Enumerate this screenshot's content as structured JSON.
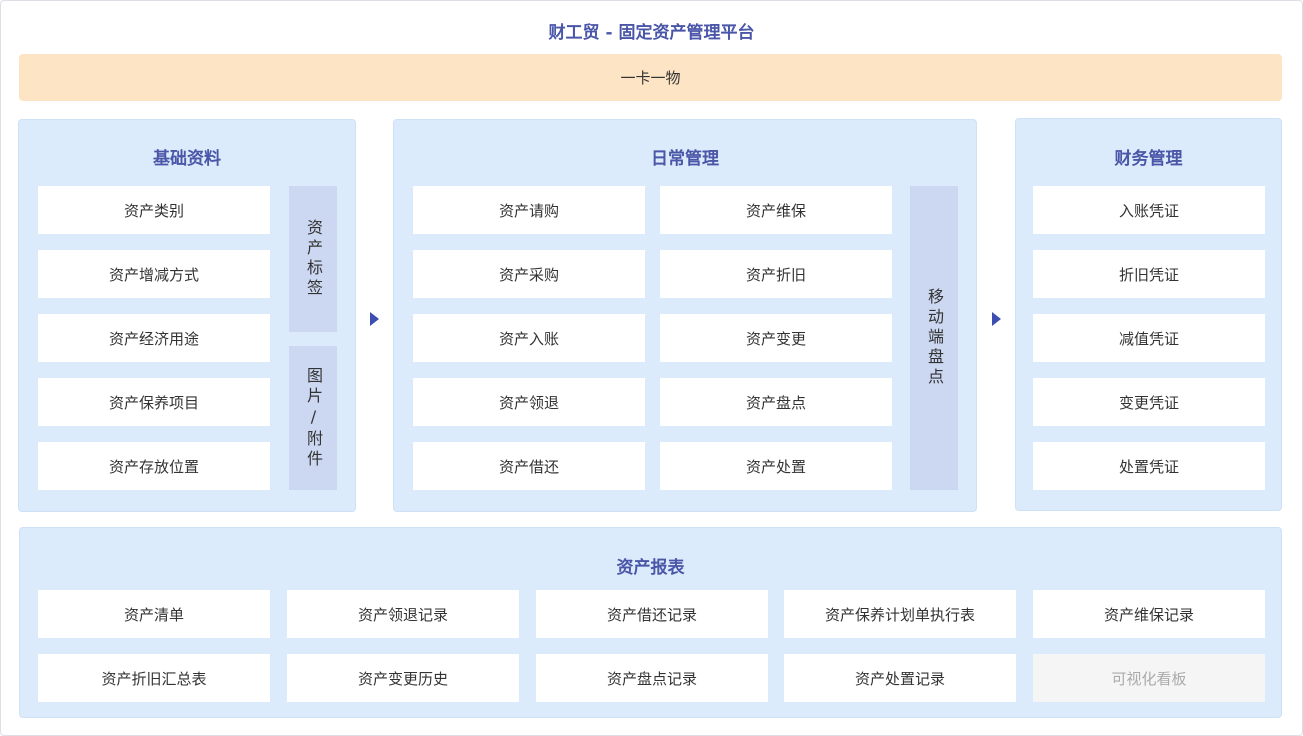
{
  "title": "财工贸 - 固定资产管理平台",
  "banner": "一卡一物",
  "basic": {
    "title": "基础资料",
    "items": [
      "资产类别",
      "资产增减方式",
      "资产经济用途",
      "资产保养项目",
      "资产存放位置"
    ],
    "side_top": "资产标签",
    "side_bottom": "图片/附件"
  },
  "daily": {
    "title": "日常管理",
    "col1": [
      "资产请购",
      "资产采购",
      "资产入账",
      "资产领退",
      "资产借还"
    ],
    "col2": [
      "资产维保",
      "资产折旧",
      "资产变更",
      "资产盘点",
      "资产处置"
    ],
    "side": "移动端盘点"
  },
  "finance": {
    "title": "财务管理",
    "items": [
      "入账凭证",
      "折旧凭证",
      "减值凭证",
      "变更凭证",
      "处置凭证"
    ]
  },
  "reports": {
    "title": "资产报表",
    "row1": [
      "资产清单",
      "资产领退记录",
      "资产借还记录",
      "资产保养计划单执行表",
      "资产维保记录"
    ],
    "row2": [
      "资产折旧汇总表",
      "资产变更历史",
      "资产盘点记录",
      "资产处置记录",
      "可视化看板"
    ]
  },
  "colors": {
    "title": "#4a56a8",
    "banner_bg": "#fde4c5",
    "panel_bg": "#dcebfb",
    "side_bg": "#ccd8f2",
    "arrow": "#3d4db0"
  }
}
